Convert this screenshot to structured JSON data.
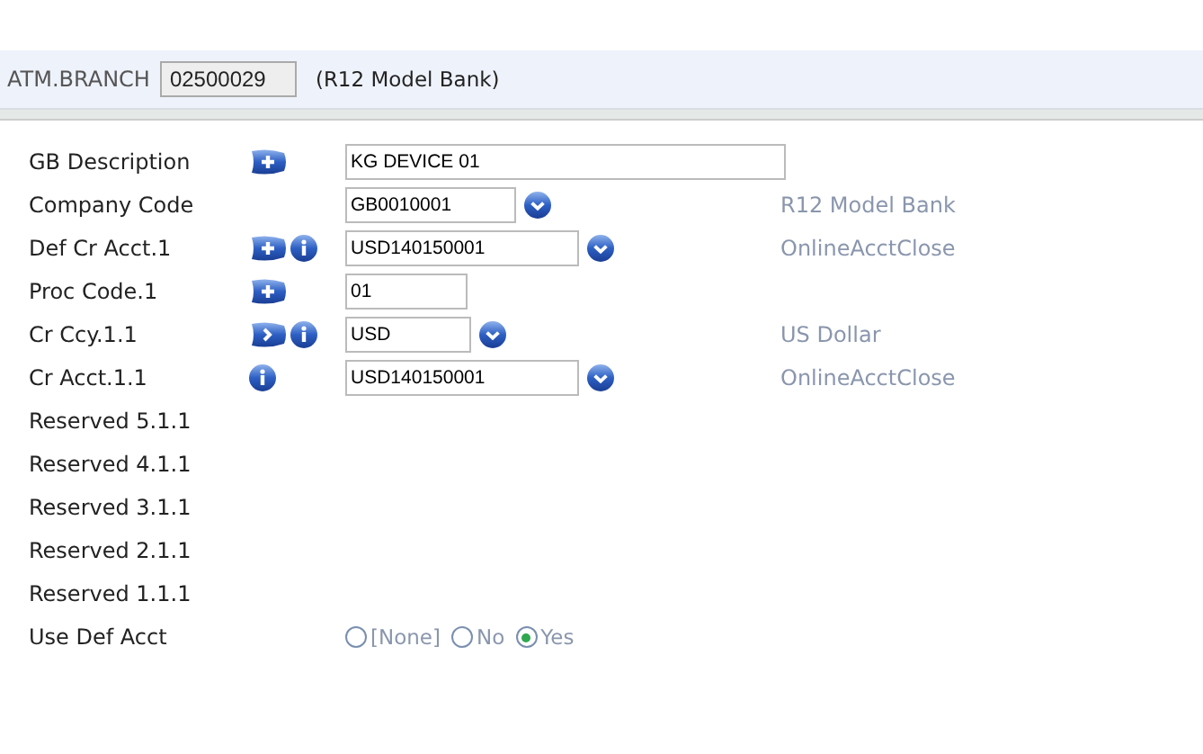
{
  "header": {
    "label": "ATM.BRANCH",
    "id_value": "02500029",
    "company": "(R12 Model Bank)"
  },
  "fields": [
    {
      "label": "GB Description",
      "icons": [
        {
          "kind": "plus"
        }
      ],
      "value": "KG DEVICE 01",
      "lookup": false
    },
    {
      "label": "Company Code",
      "value": "GB0010001",
      "lookup": true,
      "description": "R12 Model Bank"
    },
    {
      "label": "Def Cr Acct.1",
      "icons": [
        {
          "kind": "plus"
        },
        {
          "kind": "info"
        }
      ],
      "value": "USD140150001",
      "lookup": true,
      "description": "OnlineAcctClose"
    },
    {
      "label": "Proc Code.1",
      "icons": [
        {
          "kind": "plus"
        }
      ],
      "value": "01",
      "lookup": false
    },
    {
      "label": "Cr Ccy.1.1",
      "icons": [
        {
          "kind": "arrow"
        },
        {
          "kind": "info"
        }
      ],
      "value": "USD",
      "lookup": true,
      "description": "US Dollar"
    },
    {
      "label": "Cr Acct.1.1",
      "icons": [
        {
          "kind": "info"
        }
      ],
      "value": "USD140150001",
      "lookup": true,
      "description": "OnlineAcctClose"
    },
    {
      "label": "Reserved 5.1.1"
    },
    {
      "label": "Reserved 4.1.1"
    },
    {
      "label": "Reserved 3.1.1"
    },
    {
      "label": "Reserved 2.1.1"
    },
    {
      "label": "Reserved 1.1.1"
    }
  ],
  "use_def_acct": {
    "label": "Use Def Acct",
    "options": [
      {
        "label": "[None]",
        "selected": false
      },
      {
        "label": "No",
        "selected": false
      },
      {
        "label": "Yes",
        "selected": true
      }
    ]
  }
}
